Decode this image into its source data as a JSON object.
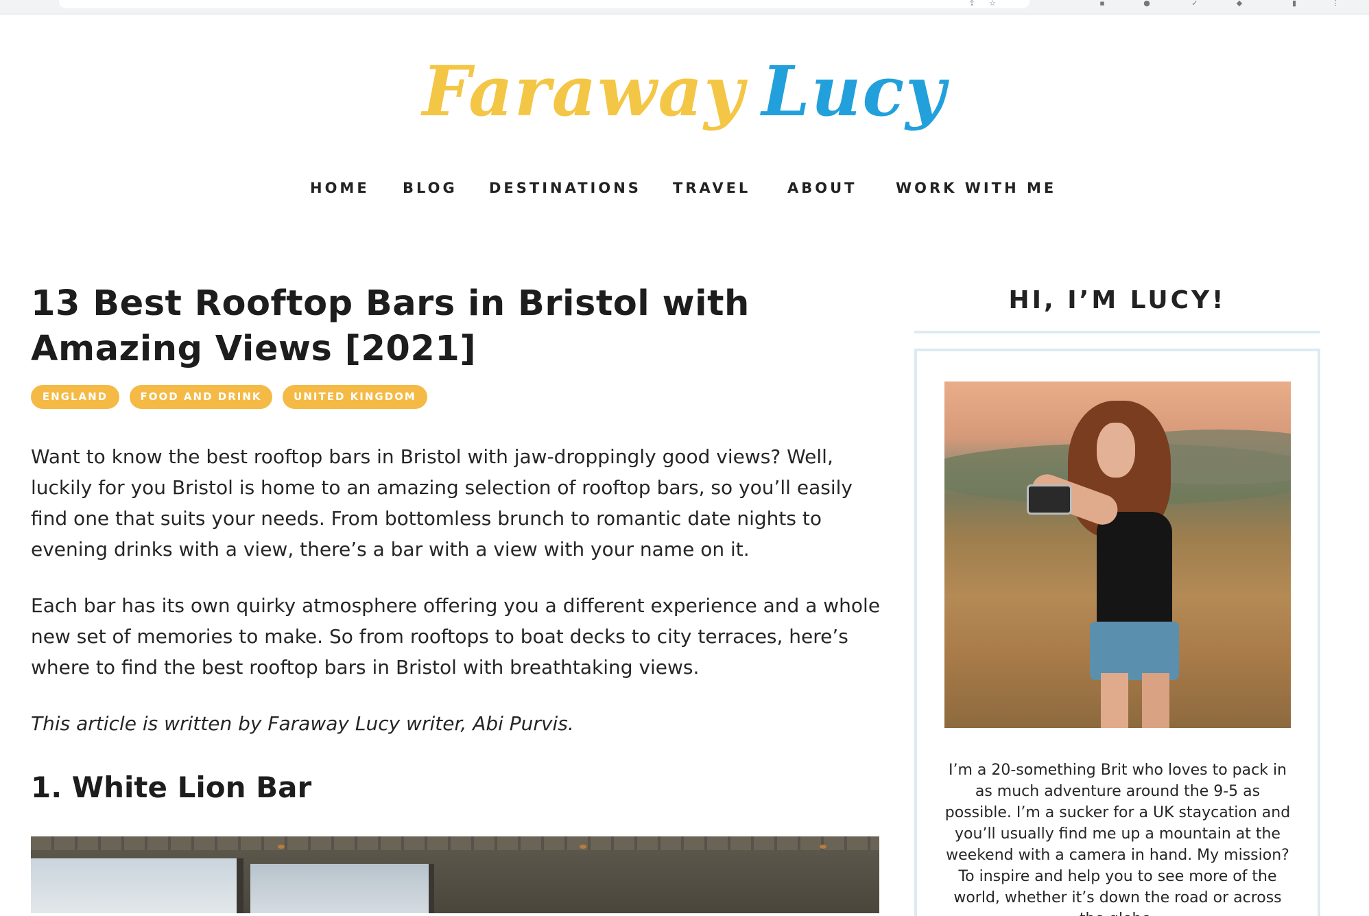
{
  "site": {
    "logo_word1": "Faraway",
    "logo_word2": "Lucy",
    "logo_colors": {
      "faraway": "#f4c646",
      "lucy": "#22a0dc"
    }
  },
  "nav": {
    "items": [
      {
        "label": "HOME"
      },
      {
        "label": "BLOG"
      },
      {
        "label": "DESTINATIONS"
      },
      {
        "label": "TRAVEL"
      },
      {
        "label": "ABOUT"
      },
      {
        "label": "WORK WITH ME"
      }
    ]
  },
  "article": {
    "title": "13 Best Rooftop Bars in Bristol with Amazing Views [2021]",
    "tags": [
      "ENGLAND",
      "FOOD AND DRINK",
      "UNITED KINGDOM"
    ],
    "tag_color": "#f4ba45",
    "paragraphs": [
      "Want to know the best rooftop bars in Bristol with jaw-droppingly good views? Well, luckily for you Bristol is home to an amazing selection of rooftop bars, so you’ll easily find one that suits your needs. From bottomless brunch to romantic date nights to evening drinks with a view, there’s a bar with a view with your name on it.",
      "Each bar has its own quirky atmosphere offering you a different experience and a whole new set of memories to make. So from rooftops to boat decks to city terraces, here’s where to find the best rooftop bars in Bristol with breathtaking views."
    ],
    "byline": "This article is written by Faraway Lucy writer, Abi Purvis.",
    "section_heading": "1. White Lion Bar"
  },
  "sidebar": {
    "title": "HI, I’M LUCY!",
    "bio": "I’m a 20-something Brit who loves to pack in as much adventure around the 9-5 as possible. I’m a sucker for a UK staycation and you’ll usually find me up a mountain at the weekend with a camera in hand. My mission? To inspire and help you to see more of the world, whether it’s down the road or across the globe.",
    "border_color": "#dceaf2"
  }
}
